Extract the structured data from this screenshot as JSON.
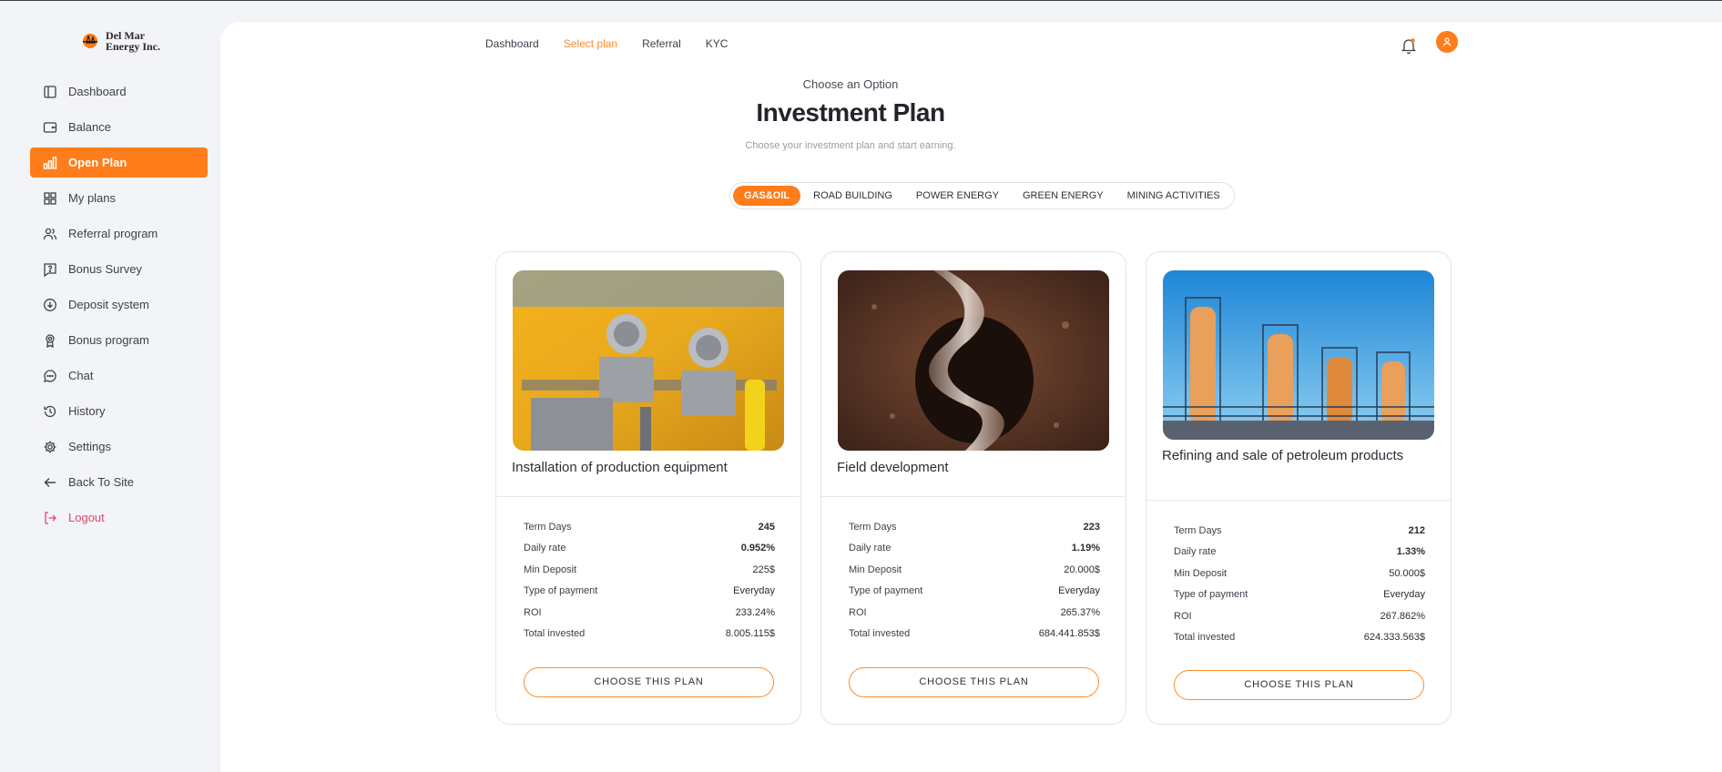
{
  "brand": {
    "name_line1": "Del Mar",
    "name_line2": "Energy Inc."
  },
  "colors": {
    "accent": "#ff7d1a",
    "logout": "#e0466b",
    "sidebar_bg": "#f3f4f7"
  },
  "sidebar": {
    "items": [
      {
        "label": "Dashboard",
        "icon": "layout-icon"
      },
      {
        "label": "Balance",
        "icon": "wallet-icon"
      },
      {
        "label": "Open Plan",
        "icon": "bar-chart-icon",
        "active": true
      },
      {
        "label": "My plans",
        "icon": "grid-icon"
      },
      {
        "label": "Referral program",
        "icon": "users-icon"
      },
      {
        "label": "Bonus Survey",
        "icon": "question-icon"
      },
      {
        "label": "Deposit system",
        "icon": "download-circle-icon"
      },
      {
        "label": "Bonus program",
        "icon": "award-icon"
      },
      {
        "label": "Chat",
        "icon": "chat-icon"
      },
      {
        "label": "History",
        "icon": "history-icon"
      },
      {
        "label": "Settings",
        "icon": "gear-icon"
      },
      {
        "label": "Back To Site",
        "icon": "arrow-left-icon"
      },
      {
        "label": "Logout",
        "icon": "logout-icon"
      }
    ]
  },
  "topnav": {
    "items": [
      "Dashboard",
      "Select plan",
      "Referral",
      "KYC"
    ],
    "active": "Select plan"
  },
  "header": {
    "subtitle": "Choose an Option",
    "title": "Investment Plan",
    "description": "Choose your investment plan and start earning."
  },
  "tabs": [
    "GAS&OIL",
    "ROAD BUILDING",
    "POWER ENERGY",
    "GREEN ENERGY",
    "MINING ACTIVITIES"
  ],
  "stat_labels": [
    "Term Days",
    "Daily rate",
    "Min Deposit",
    "Type of payment",
    "ROI",
    "Total invested"
  ],
  "plans": [
    {
      "title": "Installation of production equipment",
      "values": [
        "245",
        "0.952%",
        "225$",
        "Everyday",
        "233.24%",
        "8.005.115$"
      ],
      "button": "CHOOSE THIS PLAN"
    },
    {
      "title": "Field development",
      "values": [
        "223",
        "1.19%",
        "20.000$",
        "Everyday",
        "265.37%",
        "684.441.853$"
      ],
      "button": "CHOOSE THIS PLAN"
    },
    {
      "title": "Refining and sale of petroleum products",
      "values": [
        "212",
        "1.33%",
        "50.000$",
        "Everyday",
        "267.862%",
        "624.333.563$"
      ],
      "button": "CHOOSE THIS PLAN"
    }
  ]
}
